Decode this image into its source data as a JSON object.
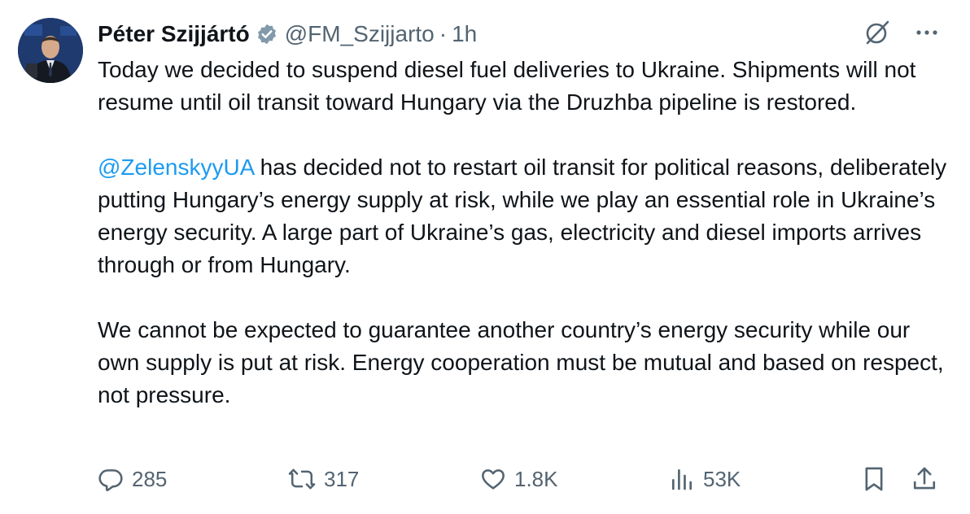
{
  "author": {
    "display_name": "Péter Szijjártó",
    "handle": "@FM_Szijjarto",
    "separator": "·",
    "time": "1h",
    "verified_icon": "verified-badge-icon"
  },
  "body": {
    "p1": "Today we decided to suspend diesel fuel deliveries to Ukraine. Shipments will not resume until oil transit toward Hungary via the Druzhba pipeline is restored.",
    "p2_mention": "@ZelenskyyUA",
    "p2_rest": " has decided not to restart oil transit for political reasons, deliberately putting Hungary’s energy supply at risk, while we play an essential role in Ukraine’s energy security. A large part of Ukraine’s gas, electricity and diesel imports arrives through or from Hungary.",
    "p3": "We cannot be expected to guarantee another country’s energy security while our own supply is put at risk. Energy cooperation must be mutual and based on respect, not pressure."
  },
  "actions": {
    "replies": "285",
    "reposts": "317",
    "likes": "1.8K",
    "views": "53K"
  },
  "colors": {
    "text": "#0f1419",
    "secondary": "#536471",
    "link": "#1d9bf0",
    "verified_badge": "#829aab"
  }
}
